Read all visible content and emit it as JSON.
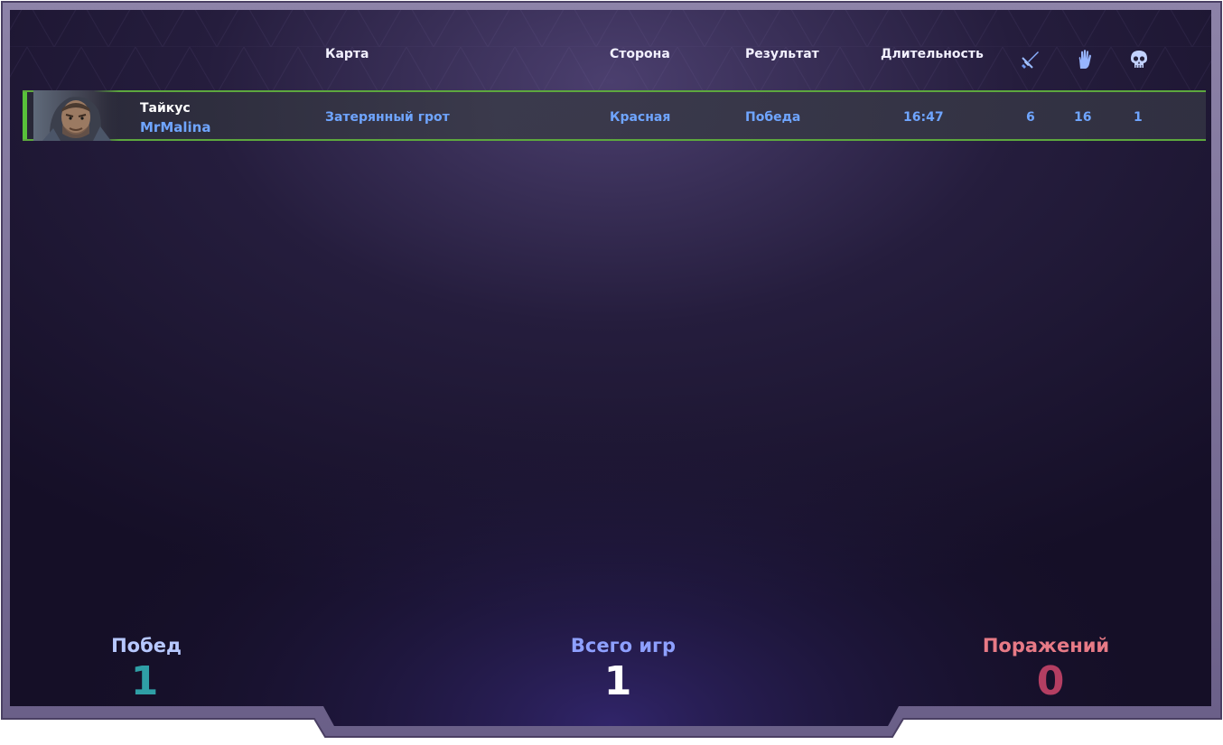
{
  "headers": {
    "map": "Карта",
    "side": "Сторона",
    "result": "Результат",
    "duration": "Длительность",
    "icons": [
      "sword-icon",
      "hand-icon",
      "skull-icon"
    ]
  },
  "rows": [
    {
      "hero": "Тайкус",
      "player": "MrMalina",
      "map": "Затерянный грот",
      "side": "Красная",
      "result": "Победа",
      "duration": "16:47",
      "stat1": "6",
      "stat2": "16",
      "stat3": "1"
    }
  ],
  "summary": {
    "wins_label": "Побед",
    "wins_value": "1",
    "total_label": "Всего игр",
    "total_value": "1",
    "losses_label": "Поражений",
    "losses_value": "0"
  },
  "colors": {
    "win_label": "#b7c8ff",
    "win_value": "#2f9fa6",
    "total_label": "#8ea0ff",
    "total_value": "#ffffff",
    "loss_label": "#e77a86",
    "loss_value": "#b43e62",
    "row_accent": "#58c13a",
    "link_text": "#6fa5ff"
  }
}
